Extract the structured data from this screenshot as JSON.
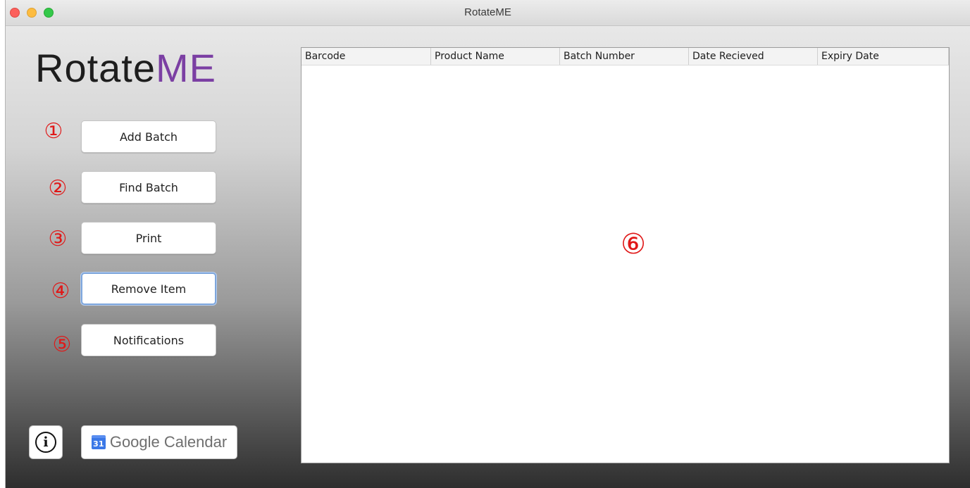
{
  "window": {
    "title": "RotateME"
  },
  "logo": {
    "part1": "Rotate",
    "part2": "ME"
  },
  "sidebar": {
    "buttons": [
      {
        "label": "Add Batch",
        "annotation": "①"
      },
      {
        "label": "Find Batch",
        "annotation": "②"
      },
      {
        "label": "Print",
        "annotation": "③"
      },
      {
        "label": "Remove Item",
        "annotation": "④"
      },
      {
        "label": "Notifications",
        "annotation": "⑤"
      }
    ],
    "info_icon_glyph": "i",
    "calendar": {
      "icon_text": "31",
      "label": "Google Calendar"
    }
  },
  "table": {
    "columns": [
      "Barcode",
      "Product Name",
      "Batch Number",
      "Date Recieved",
      "Expiry Date"
    ],
    "rows": [],
    "annotation": "⑥"
  },
  "colors": {
    "annotation_red": "#e01919",
    "logo_accent": "#7b3fa3",
    "calendar_blue": "#3b78e7"
  }
}
